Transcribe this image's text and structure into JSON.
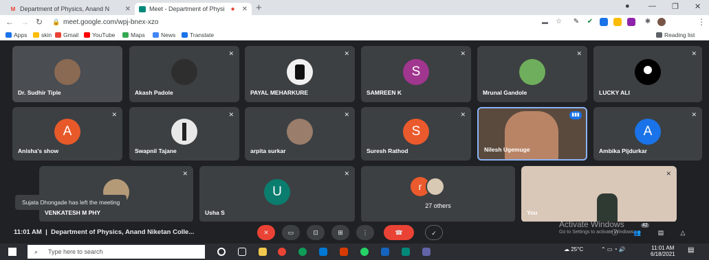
{
  "browser": {
    "tabs": [
      {
        "title": "Department of Physics, Anand N",
        "favicon": "gmail-icon",
        "color": "#ea4335"
      },
      {
        "title": "Meet - Department of Physi",
        "favicon": "meet-icon",
        "color": "#00897b"
      }
    ],
    "url": "meet.google.com/wpj-bnex-xzo",
    "bookmarks": [
      "Apps",
      "skin",
      "Gmail",
      "YouTube",
      "Maps",
      "News",
      "Translate"
    ],
    "reading_list": "Reading list"
  },
  "participants": [
    {
      "name": "Dr. Sudhir Tiple",
      "type": "photo"
    },
    {
      "name": "Akash Padole",
      "type": "photo"
    },
    {
      "name": "PAYAL MEHARKURE",
      "type": "photo"
    },
    {
      "name": "SAMREEN K",
      "type": "letter",
      "letter": "S",
      "color": "#a1368f"
    },
    {
      "name": "Mrunal Gandole",
      "type": "photo"
    },
    {
      "name": "LUCKY ALI",
      "type": "photo"
    },
    {
      "name": "Anisha's show",
      "type": "letter",
      "letter": "A",
      "color": "#e8592a"
    },
    {
      "name": "Swapnil Tajane",
      "type": "photo"
    },
    {
      "name": "arpita surkar",
      "type": "photo"
    },
    {
      "name": "Suresh Rathod",
      "type": "letter",
      "letter": "S",
      "color": "#ea5a2c"
    },
    {
      "name": "Nilesh Ugemuge",
      "type": "video"
    },
    {
      "name": "Ambika Pijdurkar",
      "type": "letter",
      "letter": "A",
      "color": "#1a73e8"
    },
    {
      "name": "VENKATESH M PHY",
      "type": "photo"
    },
    {
      "name": "Usha S",
      "type": "letter",
      "letter": "U",
      "color": "#0a7d6e"
    },
    {
      "name": "27 others",
      "type": "others",
      "letter": "r",
      "color": "#ea5a2c"
    },
    {
      "name": "You",
      "type": "video"
    }
  ],
  "toast": "Sujata Dhongade has left the meeting",
  "meeting": {
    "time": "11:01 AM",
    "separator": "|",
    "title": "Department of Physics, Anand Niketan Colle..."
  },
  "participant_count": "42",
  "windows": {
    "activate_title": "Activate Windows",
    "activate_sub": "Go to Settings to activate Windows.",
    "search_placeholder": "Type here to search",
    "temp": "25°C",
    "clock_time": "11:01 AM",
    "clock_date": "6/18/2021"
  }
}
